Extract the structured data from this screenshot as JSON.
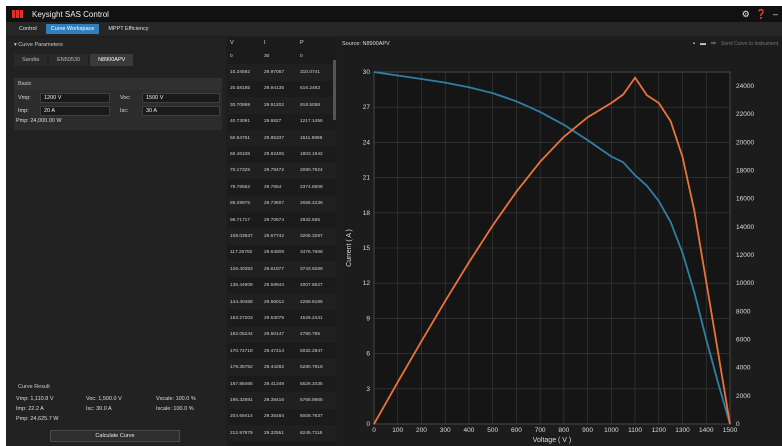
{
  "app": {
    "title": "Keysight SAS Control"
  },
  "window_icons": [
    "gear-icon",
    "help-icon",
    "minimize-icon"
  ],
  "tabs": [
    {
      "label": "Control",
      "active": false
    },
    {
      "label": "Curve Workspace",
      "active": true
    },
    {
      "label": "MPPT Efficiency",
      "active": false
    }
  ],
  "curve_params": {
    "header": "Curve Parameters",
    "subtabs": [
      "Sandia",
      "EN50530",
      "N8900APV"
    ],
    "active_subtab": "N8900APV",
    "basic_label": "Basic",
    "vmp": {
      "label": "Vmp:",
      "value": "1200 V"
    },
    "voc": {
      "label": "Voc:",
      "value": "1500 V"
    },
    "imp": {
      "label": "Imp:",
      "value": "20 A"
    },
    "isc": {
      "label": "Isc:",
      "value": "30 A"
    },
    "pmp": "Pmp: 24,000.00 W"
  },
  "result": {
    "header": "Curve Result",
    "vmp": "Vmp: 1,110.8 V",
    "voc": "Voc: 1,500.0 V",
    "vscale": "Vscale: 100.0 %",
    "imp": "Imp: 22.2 A",
    "isc": "Isc: 30.0 A",
    "iscale": "Iscale: 100.0 %",
    "pmp": "Pmp: 24,625.7 W",
    "calc_button": "Calculate Curve"
  },
  "table": {
    "headers": [
      "V",
      "I",
      "P"
    ],
    "rows": [
      [
        "0",
        "30",
        "0"
      ],
      [
        "10.34592",
        "29.97067",
        "310.0741"
      ],
      [
        "20.58185",
        "29.94135",
        "616.2483"
      ],
      [
        "30.70959",
        "29.91202",
        "918.5058"
      ],
      [
        "40.73091",
        "29.8827",
        "1217.1456"
      ],
      [
        "50.64751",
        "29.85337",
        "1511.9988"
      ],
      [
        "60.46108",
        "29.82405",
        "1803.1942"
      ],
      [
        "70.17325",
        "29.79472",
        "2090.7924"
      ],
      [
        "79.78562",
        "29.7654",
        "2374.8508"
      ],
      [
        "89.29975",
        "29.73607",
        "2655.4236"
      ],
      [
        "98.71717",
        "29.70674",
        "2932.565"
      ],
      [
        "108.03937",
        "29.67742",
        "3206.3297"
      ],
      [
        "117.26782",
        "29.64809",
        "3476.7668"
      ],
      [
        "126.40393",
        "29.61877",
        "3743.9289"
      ],
      [
        "135.44909",
        "29.58944",
        "4007.8627"
      ],
      [
        "144.40468",
        "29.56012",
        "4268.6195"
      ],
      [
        "153.27203",
        "29.53079",
        "4526.2441"
      ],
      [
        "162.05244",
        "29.50147",
        "4780.785"
      ],
      [
        "170.74718",
        "29.47214",
        "5032.2847"
      ],
      [
        "179.35752",
        "29.44282",
        "5280.7918"
      ],
      [
        "187.88466",
        "29.41349",
        "5526.3435"
      ],
      [
        "196.32981",
        "29.38416",
        "5768.9865"
      ],
      [
        "204.69414",
        "29.35484",
        "6008.7637"
      ],
      [
        "212.97879",
        "29.32551",
        "6245.7116"
      ]
    ]
  },
  "chart_panel": {
    "source": "Source: N8900APV",
    "toolbar_icons": [
      "save-icon",
      "folder-icon",
      "send-icon"
    ],
    "send_label": "Send Curve to Instrument"
  },
  "chart_data": {
    "type": "line",
    "xlabel": "Voltage ( V )",
    "ylabel": "Current ( A )",
    "xlim": [
      0,
      1500
    ],
    "ylim": [
      0,
      30
    ],
    "y2lim": [
      0,
      25000
    ],
    "xticks": [
      0,
      100,
      200,
      300,
      400,
      500,
      600,
      700,
      800,
      900,
      1000,
      1100,
      1200,
      1300,
      1400,
      1500
    ],
    "yticks": [
      0,
      3,
      6,
      9,
      12,
      15,
      18,
      21,
      24,
      27,
      30
    ],
    "y2ticks": [
      0,
      2000,
      4000,
      6000,
      8000,
      10000,
      12000,
      14000,
      16000,
      18000,
      20000,
      22000,
      24000
    ],
    "grid": true,
    "series": [
      {
        "axis": "left",
        "color": "#2f7fa6",
        "x": [
          0,
          100,
          200,
          300,
          400,
          500,
          600,
          700,
          800,
          900,
          1000,
          1050,
          1100,
          1150,
          1200,
          1250,
          1300,
          1350,
          1400,
          1450,
          1500
        ],
        "values": [
          30,
          29.7,
          29.4,
          29.1,
          28.7,
          28.2,
          27.5,
          26.6,
          25.5,
          24.2,
          22.8,
          22.3,
          21.2,
          20.3,
          19.0,
          17.2,
          14.6,
          11.2,
          7.2,
          3.5,
          0
        ]
      },
      {
        "axis": "right",
        "color": "#e8743b",
        "x": [
          0,
          100,
          200,
          300,
          400,
          500,
          600,
          700,
          800,
          900,
          1000,
          1050,
          1100,
          1150,
          1200,
          1250,
          1300,
          1350,
          1400,
          1450,
          1500
        ],
        "values": [
          0,
          2970,
          5880,
          8730,
          11480,
          14100,
          16500,
          18620,
          20400,
          21780,
          22800,
          23400,
          24600,
          23350,
          22800,
          21500,
          18980,
          15120,
          10080,
          5080,
          0
        ]
      }
    ]
  }
}
